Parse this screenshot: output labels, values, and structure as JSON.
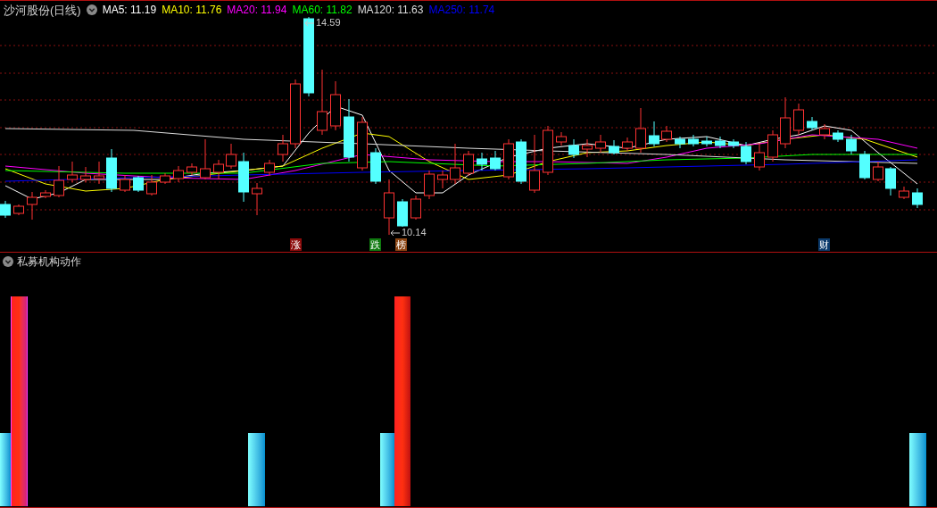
{
  "main_panel": {
    "title": "沙河股份(日线)",
    "moving_averages": [
      {
        "label": "MA5: 11.19",
        "color": "#ffffff"
      },
      {
        "label": "MA10: 11.76",
        "color": "#ffff00"
      },
      {
        "label": "MA20: 11.94",
        "color": "#ff00ff"
      },
      {
        "label": "MA60: 11.82",
        "color": "#00ff00"
      },
      {
        "label": "MA120: 11.63",
        "color": "#dddddd"
      },
      {
        "label": "MA250: 11.74",
        "color": "#0000ff"
      }
    ],
    "price_labels": [
      "14.59",
      "10.14"
    ],
    "markers": [
      {
        "text": "涨",
        "color": "#8b0b0b"
      },
      {
        "text": "跌",
        "color": "#0f7a0f"
      },
      {
        "text": "榜",
        "color": "#8b4513"
      },
      {
        "text": "财",
        "color": "#0b3a6b"
      }
    ]
  },
  "indicator_panel": {
    "title": "私募机构动作"
  }
}
